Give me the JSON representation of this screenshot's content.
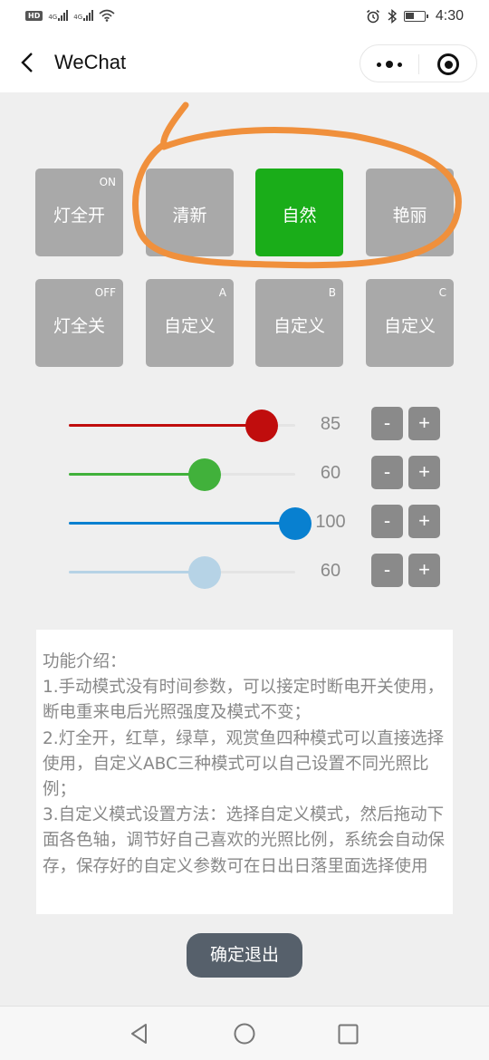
{
  "status_bar": {
    "left_badges": [
      "HD",
      "4G",
      "4G"
    ],
    "icons": [
      "alarm-icon",
      "bluetooth-icon",
      "battery-icon"
    ],
    "time": "4:30"
  },
  "navbar": {
    "title": "WeChat",
    "back_icon": "chevron-left-icon",
    "more_icon": "more-dots-icon",
    "close_icon": "target-close-icon"
  },
  "modes": [
    {
      "label": "灯全开",
      "tag": "ON",
      "active": false
    },
    {
      "label": "清新",
      "tag": "",
      "active": false
    },
    {
      "label": "自然",
      "tag": "",
      "active": true
    },
    {
      "label": "艳丽",
      "tag": "",
      "active": false
    },
    {
      "label": "灯全关",
      "tag": "OFF",
      "active": false
    },
    {
      "label": "自定义",
      "tag": "A",
      "active": false
    },
    {
      "label": "自定义",
      "tag": "B",
      "active": false
    },
    {
      "label": "自定义",
      "tag": "C",
      "active": false
    }
  ],
  "sliders": [
    {
      "channel": "red",
      "value": 85,
      "value_text": "85",
      "min": 0,
      "max": 100,
      "color": "#c00d0d",
      "fill_color": "#c00d0d"
    },
    {
      "channel": "green",
      "value": 60,
      "value_text": "60",
      "min": 0,
      "max": 100,
      "color": "#41b13b",
      "fill_color": "#41b13b"
    },
    {
      "channel": "blue",
      "value": 100,
      "value_text": "100",
      "min": 0,
      "max": 100,
      "color": "#0880d0",
      "fill_color": "#0880d0"
    },
    {
      "channel": "white",
      "value": 60,
      "value_text": "60",
      "min": 0,
      "max": 100,
      "color": "#b6d3e6",
      "fill_color": "#b6d3e6"
    }
  ],
  "stepper": {
    "minus_label": "-",
    "plus_label": "+"
  },
  "info": {
    "lines": [
      "功能介绍：",
      "1.手动模式没有时间参数，可以接定时断电开关使用，断电重来电后光照强度及模式不变；",
      "2.灯全开，红草，绿草，观赏鱼四种模式可以直接选择使用，自定义ABC三种模式可以自己设置不同光照比例；",
      "3.自定义模式设置方法：选择自定义模式，然后拖动下面各色轴，调节好自己喜欢的光照比例，系统会自动保存，保存好的自定义参数可在日出日落里面选择使用"
    ]
  },
  "exit_button": {
    "label": "确定退出"
  },
  "system_nav": {
    "back": "triangle-back-icon",
    "home": "circle-home-icon",
    "recents": "square-recents-icon"
  },
  "annotation": {
    "color": "#f0903c",
    "shape": "hand-drawn-ellipse"
  },
  "colors": {
    "active_mode": "#1aad19",
    "inactive_mode": "#a9a9a9",
    "stepper": "#8a8a8a",
    "exit_button": "#56606b"
  }
}
